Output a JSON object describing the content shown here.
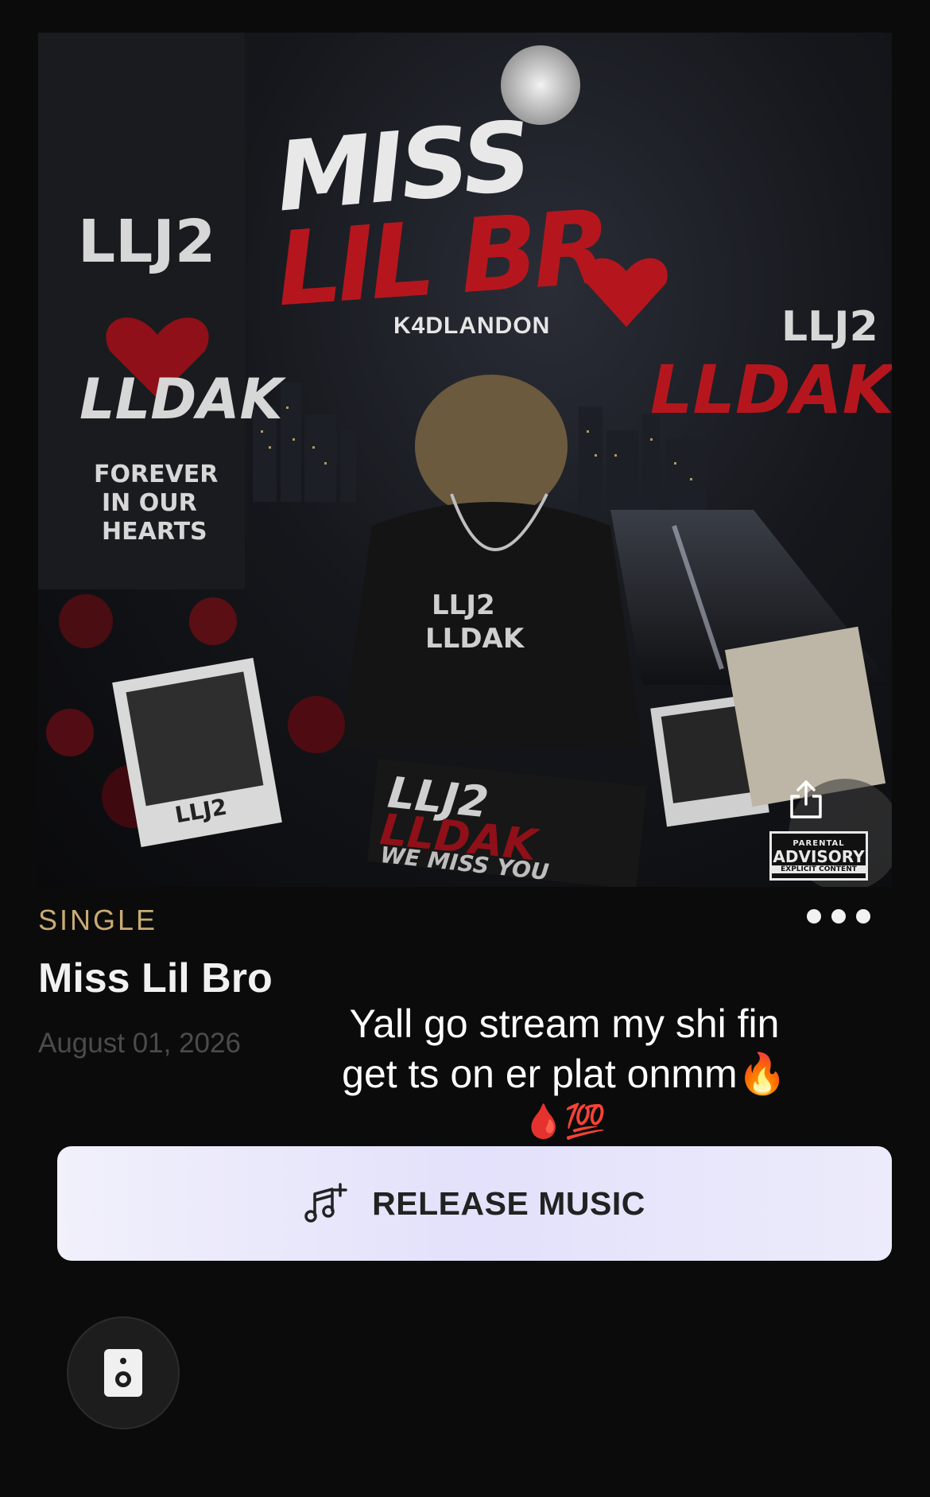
{
  "cover": {
    "title_line1": "MISS",
    "title_line2": "LIL BR",
    "artist": "K4DLANDON",
    "left_text_1": "LLJ2",
    "left_text_2": "LLDAK",
    "left_text_3": "FOREVER",
    "left_text_4": "IN OUR",
    "left_text_5": "HEARTS",
    "right_text_1": "LLJ2",
    "right_text_2": "LLDAK",
    "shirt_text_1": "LLJ2",
    "shirt_text_2": "LLDAK",
    "photo_label": "LLJ2",
    "bottom_text_1": "LLJ2",
    "bottom_text_2": "LLDAK",
    "bottom_text_3": "WE MISS YOU",
    "advisory_top": "PARENTAL",
    "advisory_mid": "ADVISORY",
    "advisory_bottom": "EXPLICIT CONTENT",
    "accent_red": "#b5161d"
  },
  "release": {
    "type": "SINGLE",
    "title": "Miss Lil Bro",
    "date": "August 01, 2026"
  },
  "caption": {
    "line1": "Yall go stream my shi fin",
    "line2": "get ts on er plat onmm🔥",
    "line3": "🩸💯"
  },
  "actions": {
    "release_label": "RELEASE MUSIC",
    "share_icon": "share-icon",
    "more_icon": "more-icon",
    "speaker_icon": "speaker-icon",
    "accent_gold": "#c9ab73"
  }
}
